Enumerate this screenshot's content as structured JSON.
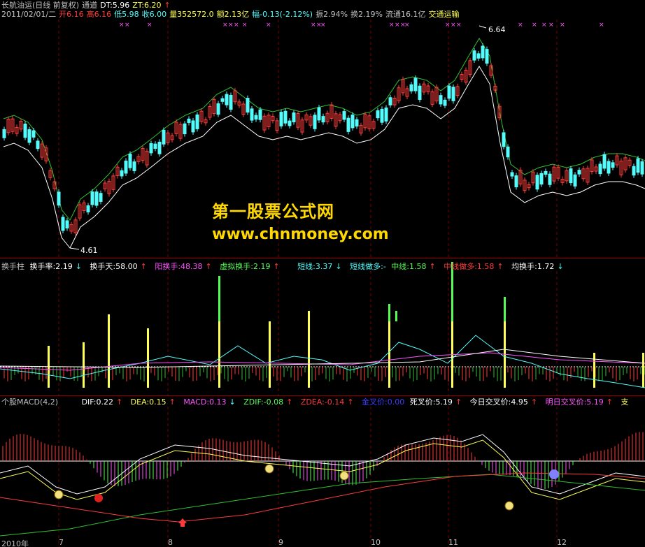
{
  "colors": {
    "up": "#ff3c3c",
    "down": "#54fcfc",
    "bg": "#000000",
    "grid": "#7a0000",
    "ma_green": "#30c030",
    "white": "#ffffff",
    "yellow": "#ffff54",
    "magenta": "#ff54ff",
    "blue": "#3c3cff",
    "watermark": "#ffd800"
  },
  "header1": {
    "stock": "长航油运(日线 前复权)",
    "indicator": "通道",
    "dt": "DT:5.96",
    "zt": "ZT:6.20",
    "date": "2011/02/01/二",
    "open": "开6.16",
    "high": "高6.16",
    "low": "低5.98",
    "close": "收6.00",
    "volume": "量352572.0",
    "amount": "额2.13亿",
    "change": "幅-0.13(-2.12%)",
    "amplitude": "振2.94%",
    "turnover": "换2.19%",
    "float": "流通16.1亿",
    "sector": "交通运输"
  },
  "price_labels": {
    "high_mark": "6.64",
    "low_mark": "4.61"
  },
  "watermark": {
    "cn": "第一股票公式网",
    "url": "www.chnmoney.com"
  },
  "header2": {
    "name": "换手柱",
    "rate": "换手率:2.19",
    "days": "换手天:58.00",
    "yang": "阳换手:48.38",
    "virtual": "虚拟换手:2.19",
    "short": "短线:3.37",
    "short_long": "短线做多:-",
    "mid": "中线:1.58",
    "mid_long": "中线做多:1.58",
    "avg": "均换手:1.72"
  },
  "header3": {
    "name": "个股MACD(4,2)",
    "dif": "DIF:0.22",
    "dea": "DEA:0.15",
    "macd": "MACD:0.13",
    "zdif": "ZDIF:-0.08",
    "zdea": "ZDEA:-0.14",
    "golden": "金叉价:0.00",
    "death": "死叉价:5.19",
    "today_cross": "今日交叉价:4.95",
    "tomorrow_cross": "明日交叉价:5.19",
    "cut": "支"
  },
  "x_axis": [
    "2010年",
    "7",
    "8",
    "9",
    "10",
    "11",
    "12"
  ]
}
